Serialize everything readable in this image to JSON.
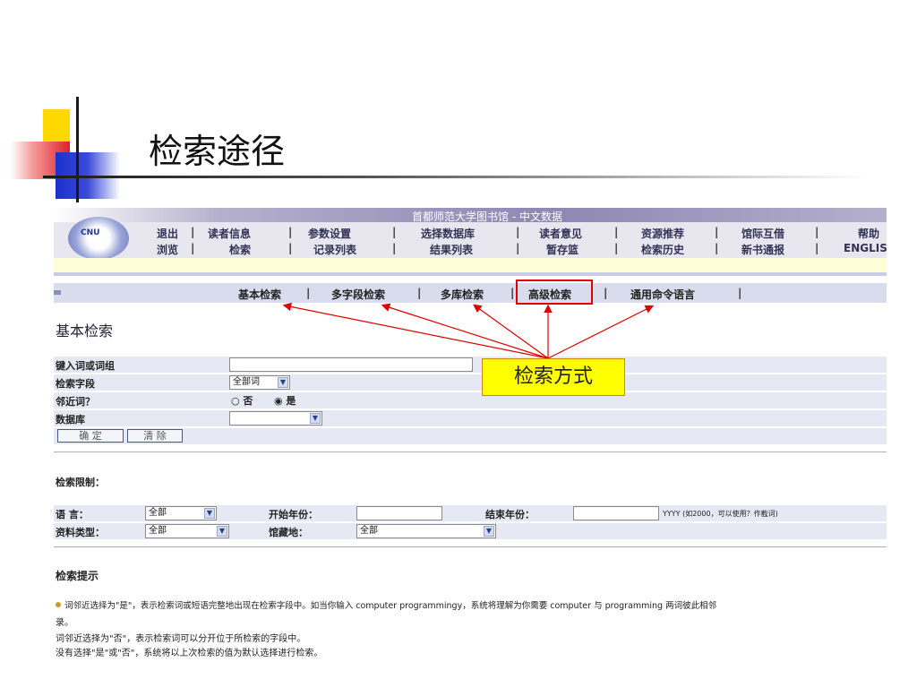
{
  "slide": {
    "title": "检索途径"
  },
  "banner": {
    "title": "首都师范大学图书馆 - 中文数据",
    "logo_text": "CNU",
    "menu_row1": [
      "退出",
      "读者信息",
      "参数设置",
      "选择数据库",
      "读者意见",
      "资源推荐",
      "馆际互借",
      "帮助"
    ],
    "menu_row2": [
      "浏览",
      "检索",
      "记录列表",
      "结果列表",
      "暂存篮",
      "检索历史",
      "新书通报",
      "ENGLIS"
    ]
  },
  "subnav": {
    "items": [
      "基本检索",
      "多字段检索",
      "多库检索",
      "高级检索",
      "通用命令语言"
    ]
  },
  "form": {
    "heading": "基本检索",
    "keyword_label": "键入词或词组",
    "keyword_value": "",
    "field_label": "检索字段",
    "field_value": "全部词",
    "adjacent_label": "邻近词？",
    "adjacent_no": "○ 否",
    "adjacent_yes": "◉ 是",
    "database_label": "数据库",
    "database_value": "",
    "ok_button": "确 定",
    "clear_button": "清 除"
  },
  "limits": {
    "heading": "检索限制：",
    "language_label": "语 言：",
    "language_value": "全部",
    "start_year_label": "开始年份：",
    "start_year_value": "",
    "end_year_label": "结束年份：",
    "end_year_value": "",
    "year_hint": "YYYY (如2000，可以使用？作截词)",
    "material_label": "资料类型：",
    "material_value": "全部",
    "location_label": "馆藏地：",
    "location_value": "全部"
  },
  "tips": {
    "heading": "检索提示",
    "line1": "词邻近选择为\"是\"，表示检索词或短语完整地出现在检索字段中。如当你输入 computer programmingy，系统将理解为你需要 computer 与 programming 两词彼此相邻",
    "line1b": "录。",
    "line2": "词邻近选择为\"否\"，表示检索词可以分开位于所检索的字段中。",
    "line3": "没有选择\"是\"或\"否\"，系统将以上次检索的值为默认选择进行检索。"
  },
  "callout": {
    "text": "检索方式"
  },
  "colors": {
    "highlight": "#e00000",
    "callout_bg": "#ffff00",
    "nav_bg": "#d8dcec",
    "row_bg": "#e6e9f3"
  }
}
